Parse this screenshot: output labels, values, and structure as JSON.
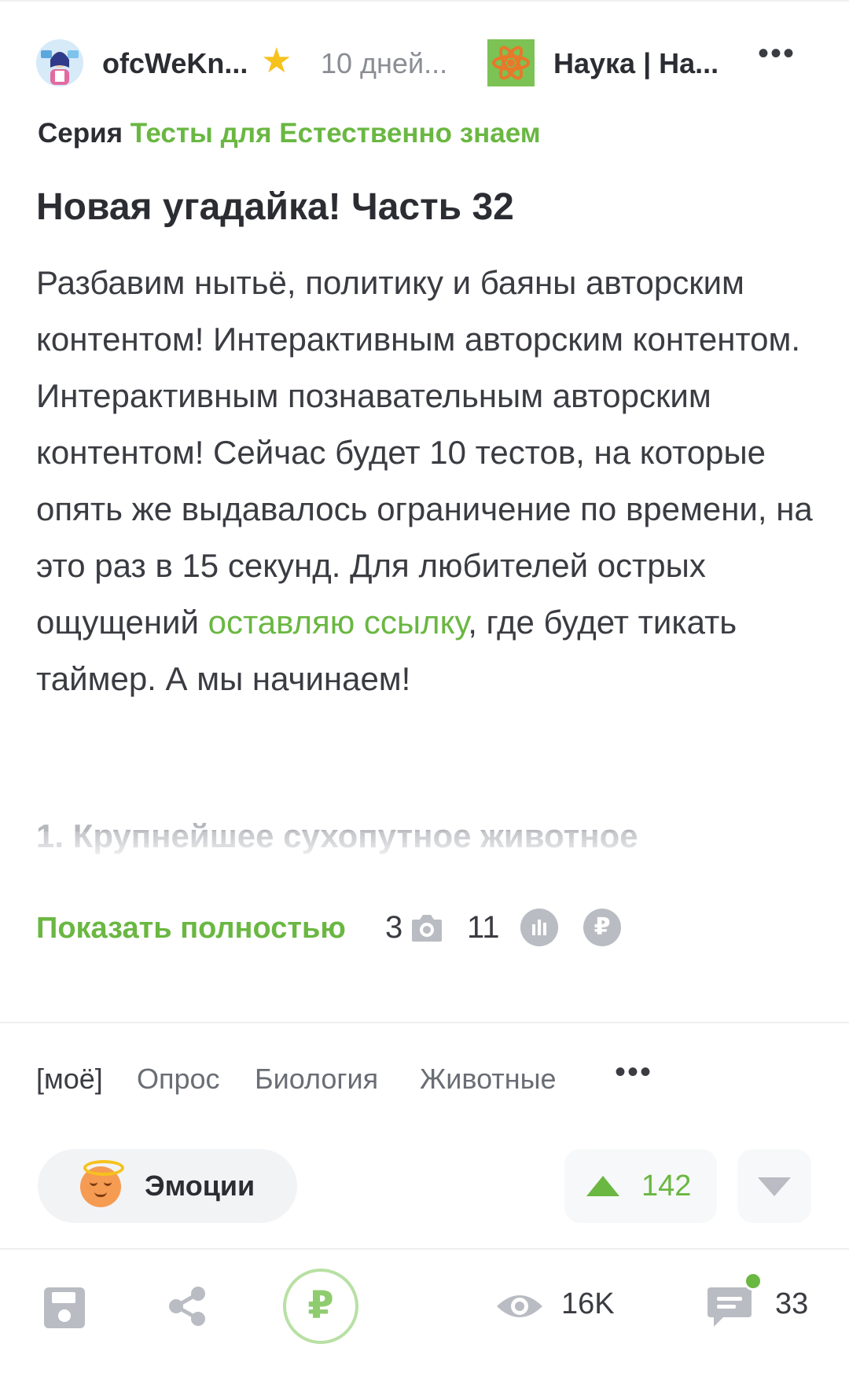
{
  "header": {
    "author": "ofcWeKn...",
    "time": "10 дней...",
    "community": "Наука | На...",
    "more": "•••"
  },
  "series": {
    "label": "Серия",
    "link": "Тесты для Естественно знаем"
  },
  "post": {
    "title": "Новая угадайка! Часть 32",
    "text_before_link": "Разбавим нытьё, политику и баяны авторским контентом! Интерактивным авторским контентом. Интерактивным познавательным авторским контентом! Сейчас будет 10 тестов, на которые опять же выдавалось ограничение по времени, на это раз в 15 секунд. Для любителей острых ощущений ",
    "link_text": "оставляю ссылку",
    "text_after_link": ", где будет тикать таймер. А мы начинаем!",
    "next_heading": "1. Крупнейшее сухопутное животное"
  },
  "expand": {
    "show_full": "Показать полностью",
    "photos_count": "3",
    "polls_count": "11"
  },
  "tags": [
    "[моё]",
    "Опрос",
    "Биология",
    "Животные"
  ],
  "tags_more": "•••",
  "emotions_label": "Эмоции",
  "rating": "142",
  "bottom": {
    "ruble": "₽",
    "views": "16K",
    "comments": "33"
  },
  "colors": {
    "accent": "#6ab742",
    "text": "#2b2d33",
    "muted": "#8a8d94",
    "icon_gray": "#b9bcc2"
  }
}
